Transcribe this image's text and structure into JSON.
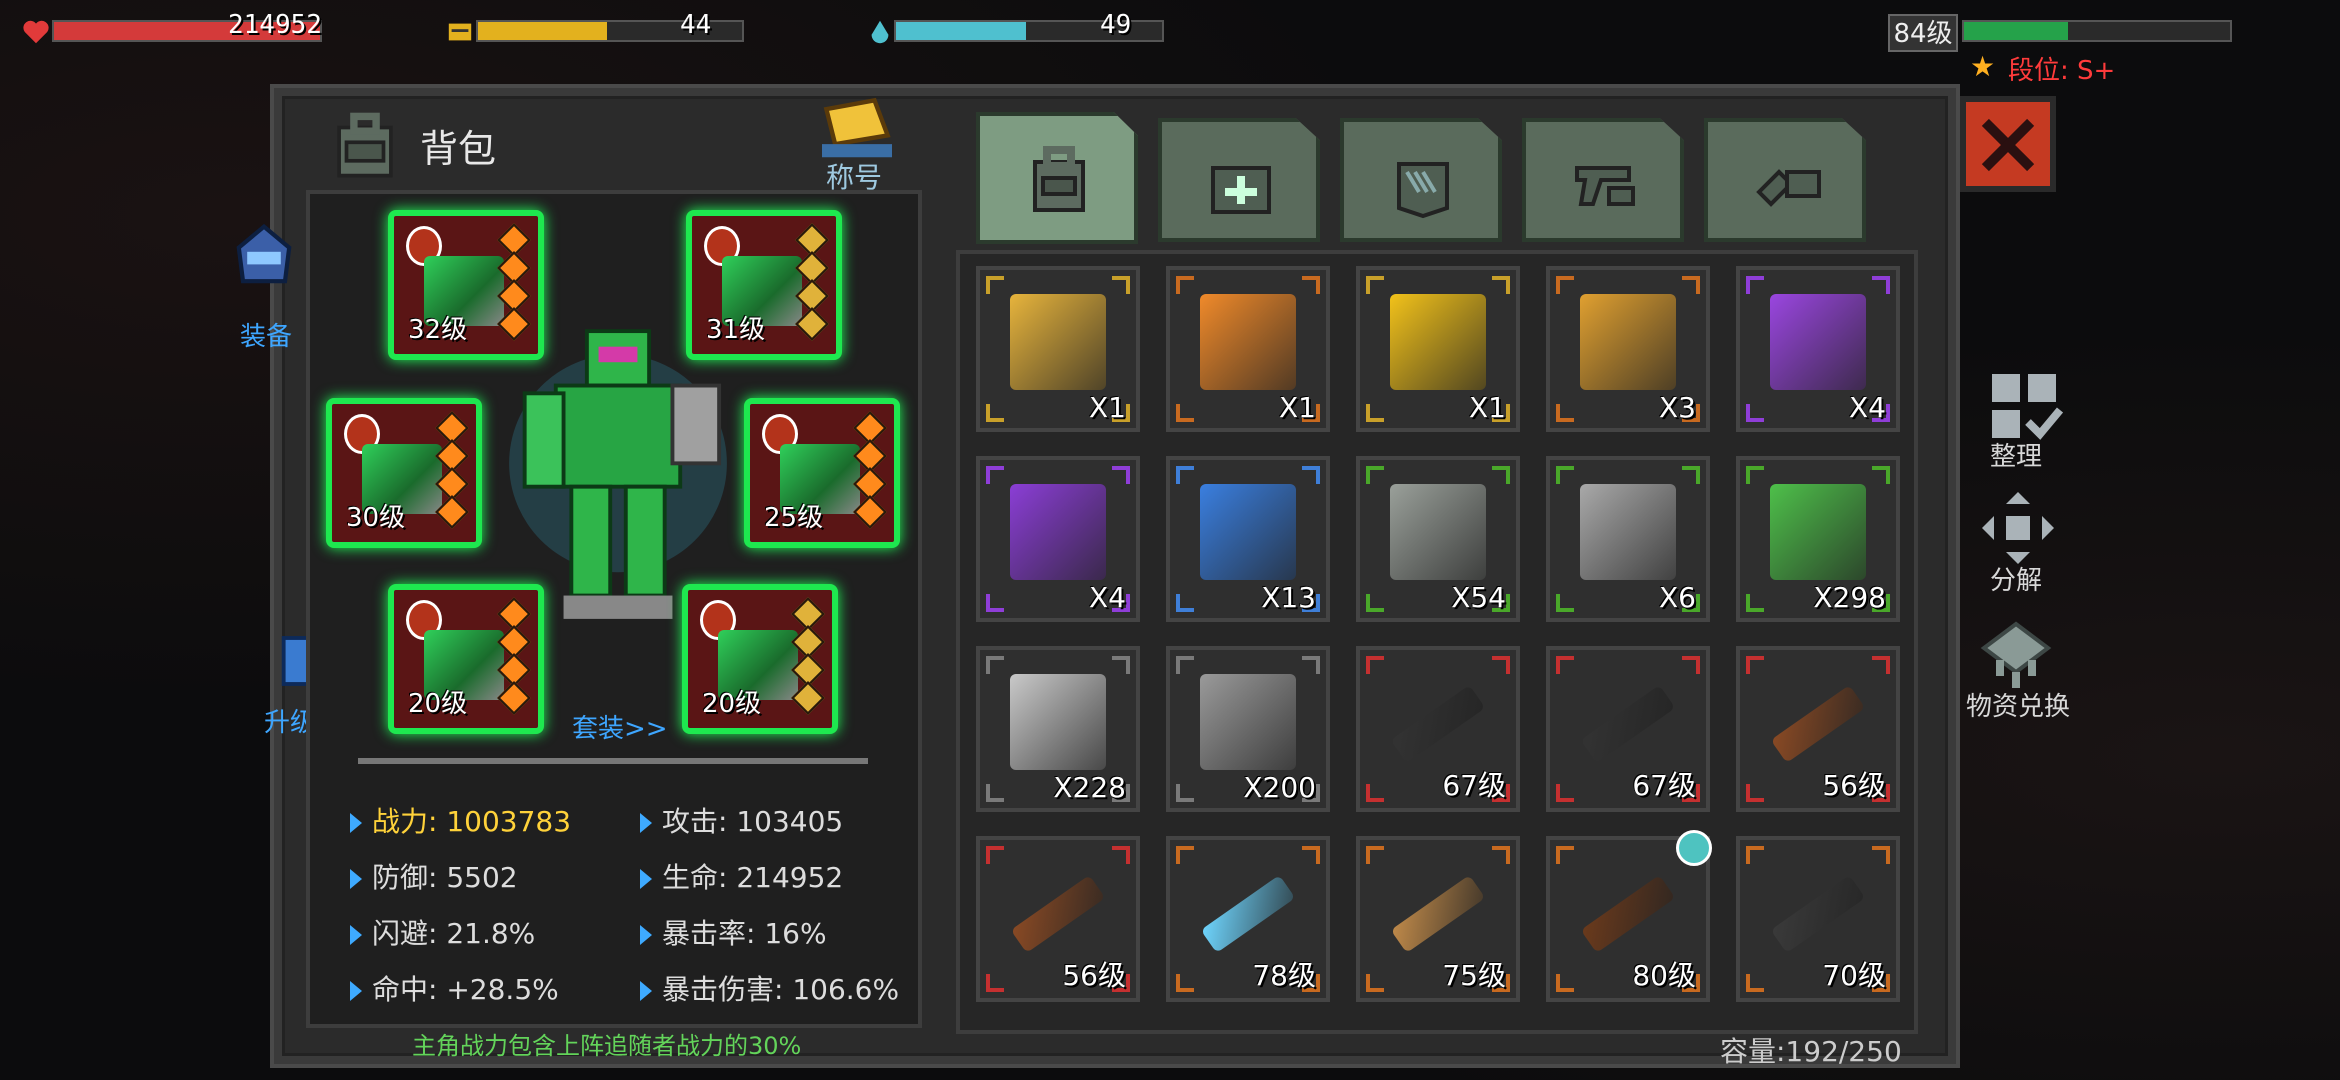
{
  "hud": {
    "hp_value": "214952",
    "hp_fraction": 1.0,
    "energy_value": "44",
    "energy_fraction": 0.49,
    "water_value": "49",
    "water_fraction": 0.49,
    "level_label": "84级",
    "xp_fraction": 0.39,
    "rank_label": "段位: S+",
    "colors": {
      "hp": "#d43a3a",
      "energy": "#e3b11e",
      "water": "#4fc0cf",
      "xp": "#25a24a"
    }
  },
  "panel": {
    "title": "背包",
    "title_badge_label": "称号",
    "left_side": {
      "equip_label": "装备",
      "upgrade_label": "升级大师"
    },
    "right_side": {
      "sort_label": "整理",
      "decompose_label": "分解",
      "exchange_label": "物资兑换"
    },
    "set_link": "套装>>",
    "note": "主角战力包含上阵追随者战力的30%",
    "capacity": "容量:192/250"
  },
  "equipment_slots": [
    {
      "level": "32级",
      "gem_color": "orange"
    },
    {
      "level": "31级",
      "gem_color": "gold"
    },
    {
      "level": "30级",
      "gem_color": "orange"
    },
    {
      "level": "25级",
      "gem_color": "orange"
    },
    {
      "level": "20级",
      "gem_color": "orange"
    },
    {
      "level": "20级",
      "gem_color": "gold"
    }
  ],
  "stats": {
    "power": "战力: 1003783",
    "attack": "攻击: 103405",
    "defense": "防御: 5502",
    "hp": "生命: 214952",
    "dodge": "闪避: 21.8%",
    "crit_rate": "暴击率: 16%",
    "hit": "命中: +28.5%",
    "crit_dmg": "暴击伤害: 106.6%"
  },
  "tabs": [
    {
      "icon": "backpack-icon",
      "active": true
    },
    {
      "icon": "medkit-icon",
      "active": false
    },
    {
      "icon": "armor-icon",
      "active": false
    },
    {
      "icon": "pistol-icon",
      "active": false
    },
    {
      "icon": "wrench-icon",
      "active": false
    }
  ],
  "items": [
    {
      "label": "X1",
      "rarity": "gold",
      "kind": "exp-badge",
      "art_color": "#e7b43c"
    },
    {
      "label": "X1",
      "rarity": "orange",
      "kind": "crate",
      "art_color": "#f08a2a"
    },
    {
      "label": "X1",
      "rarity": "gold",
      "kind": "crate",
      "art_color": "#f2c21a"
    },
    {
      "label": "X3",
      "rarity": "orange",
      "kind": "chest",
      "art_color": "#e0a030"
    },
    {
      "label": "X4",
      "rarity": "purple",
      "kind": "crate",
      "art_color": "#9a46e0"
    },
    {
      "label": "X4",
      "rarity": "purple",
      "kind": "chest",
      "art_color": "#8b3ed6"
    },
    {
      "label": "X13",
      "rarity": "blue",
      "kind": "crate",
      "art_color": "#3a7fe0"
    },
    {
      "label": "X54",
      "rarity": "green",
      "kind": "chest",
      "art_color": "#9aa09a"
    },
    {
      "label": "X6",
      "rarity": "green",
      "kind": "chest",
      "art_color": "#a9a9a9"
    },
    {
      "label": "X298",
      "rarity": "green",
      "kind": "chest",
      "art_color": "#4ec04a"
    },
    {
      "label": "X228",
      "rarity": "gray",
      "kind": "chest",
      "art_color": "#c9c9c9"
    },
    {
      "label": "X200",
      "rarity": "gray",
      "kind": "chest",
      "art_color": "#9a9a9a"
    },
    {
      "label": "67级",
      "rarity": "red",
      "kind": "gun",
      "art_color": "#333333"
    },
    {
      "label": "67级",
      "rarity": "red",
      "kind": "gun",
      "art_color": "#333333"
    },
    {
      "label": "56级",
      "rarity": "red",
      "kind": "rifle",
      "art_color": "#8a4a24"
    },
    {
      "label": "56级",
      "rarity": "red",
      "kind": "rifle",
      "art_color": "#8a4a24"
    },
    {
      "label": "78级",
      "rarity": "orange",
      "kind": "blade",
      "art_color": "#6fd6ff"
    },
    {
      "label": "75级",
      "rarity": "orange",
      "kind": "bat",
      "art_color": "#c08a4a"
    },
    {
      "label": "80级",
      "rarity": "orange",
      "kind": "rifle",
      "art_color": "#6b3a1c",
      "badge": true
    },
    {
      "label": "70级",
      "rarity": "orange",
      "kind": "rifle",
      "art_color": "#3a3a3a"
    }
  ]
}
